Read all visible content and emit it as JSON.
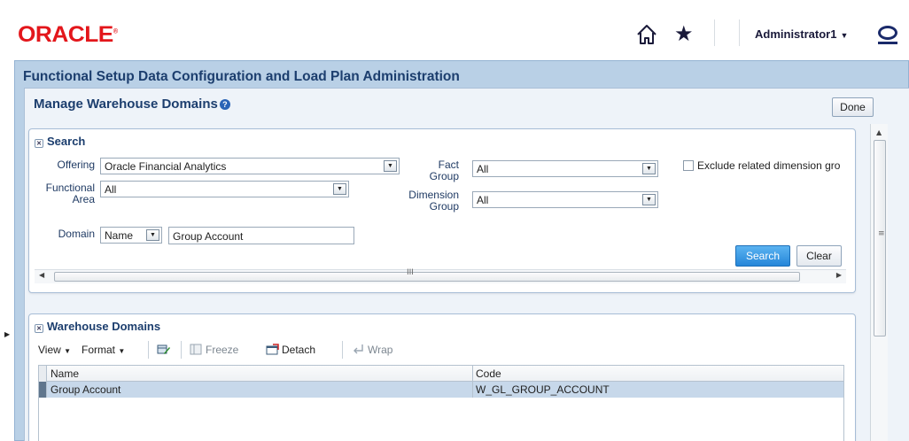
{
  "header": {
    "logo": "ORACLE",
    "logo_mark": "®",
    "user": "Administrator1",
    "icons": [
      "home-icon",
      "star-icon",
      "caret-down-icon",
      "oracle-ring-icon"
    ]
  },
  "app": {
    "title": "Functional Setup Data Configuration and Load Plan Administration"
  },
  "page": {
    "title": "Manage Warehouse Domains",
    "help": "?",
    "done_label": "Done",
    "done_mnemonic": "o"
  },
  "search": {
    "heading": "Search",
    "offering_label": "Offering",
    "offering_value": "Oracle Financial Analytics",
    "functional_area_label_1": "Functional",
    "functional_area_label_2": "Area",
    "functional_area_value": "All",
    "fact_group_label_1": "Fact",
    "fact_group_label_2": "Group",
    "fact_group_value": "All",
    "dimension_group_label_1": "Dimension",
    "dimension_group_label_2": "Group",
    "dimension_group_value": "All",
    "exclude_label": "Exclude related dimension gro",
    "exclude_checked": false,
    "domain_label": "Domain",
    "domain_operator": "Name",
    "domain_value": "Group Account",
    "search_button": "Search",
    "clear_button": "Clear",
    "hscroll_grip": "III"
  },
  "domains": {
    "heading": "Warehouse Domains",
    "toolbar": {
      "view": "View",
      "format": "Format",
      "freeze": "Freeze",
      "detach": "Detach",
      "wrap": "Wrap"
    },
    "columns": [
      "Name",
      "Code"
    ],
    "rows": [
      {
        "name": "Group Account",
        "code": "W_GL_GROUP_ACCOUNT"
      }
    ]
  },
  "colors": {
    "brand_red": "#e3161b",
    "title_navy": "#1c3e6e",
    "primary_button": "#2586d9",
    "selected_row": "#c7d8ea"
  }
}
